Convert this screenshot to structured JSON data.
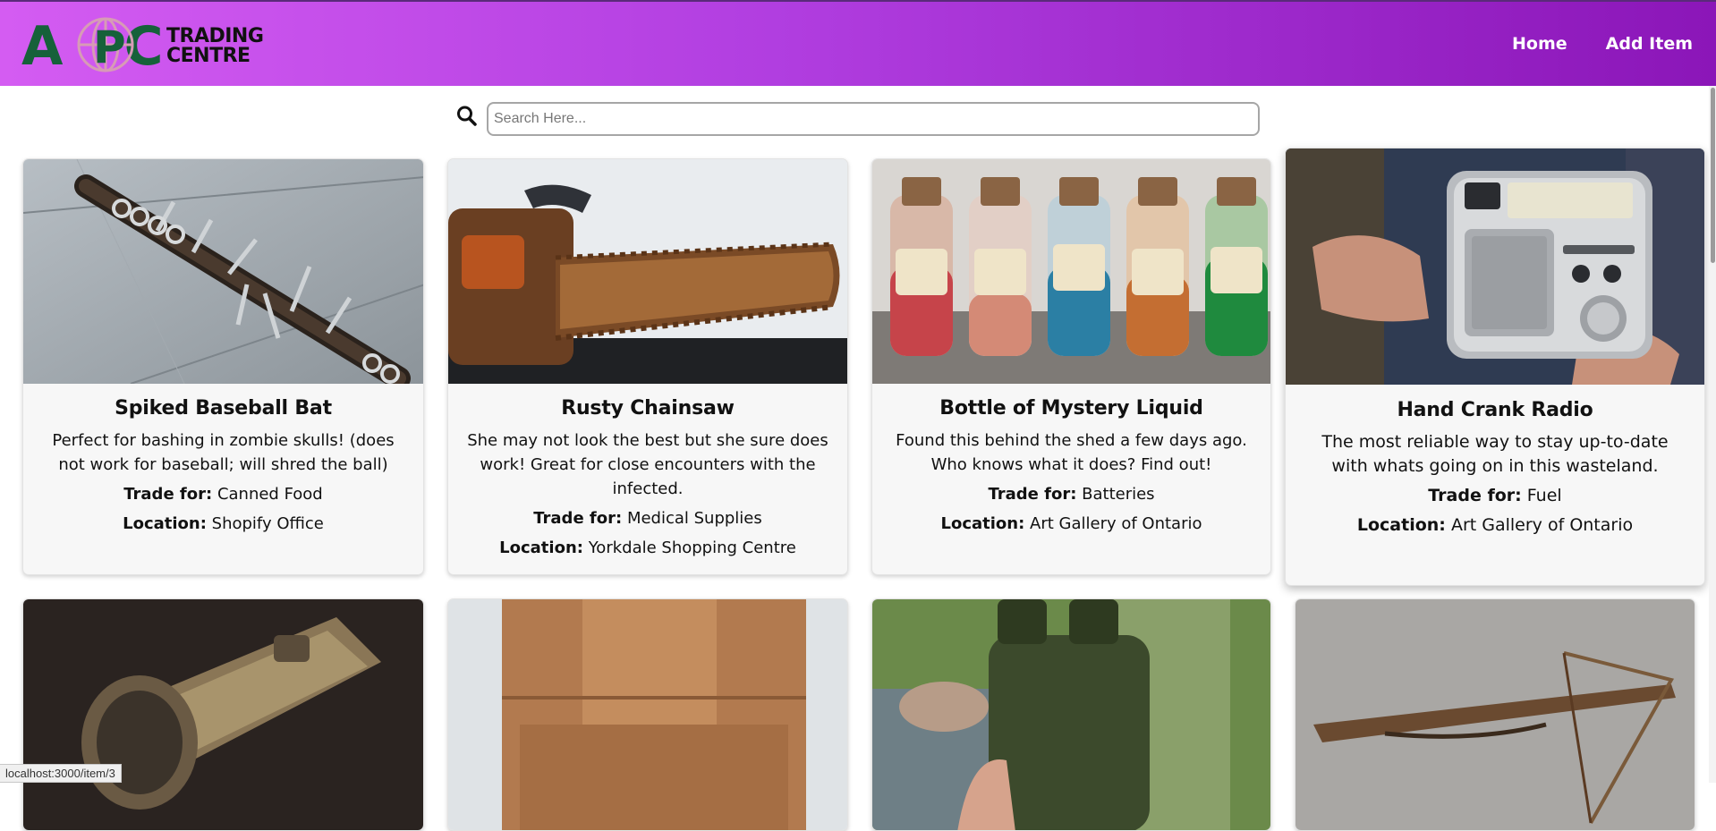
{
  "header": {
    "logo_letters": "APC",
    "logo_sub_line1": "TRADING",
    "logo_sub_line2": "CENTRE",
    "nav": [
      {
        "label": "Home"
      },
      {
        "label": "Add Item"
      }
    ],
    "gradient_colors": [
      "#d45cf2",
      "#8b16b8"
    ]
  },
  "search": {
    "placeholder": "Search Here...",
    "value": "",
    "icon": "search-icon"
  },
  "trade_label": "Trade for:",
  "location_label": "Location:",
  "items": [
    {
      "title": "Spiked Baseball Bat",
      "description": "Perfect for bashing in zombie skulls! (does not work for baseball; will shred the ball)",
      "trade_for": "Canned Food",
      "location": "Shopify Office",
      "image": "spiked-bat-photo"
    },
    {
      "title": "Rusty Chainsaw",
      "description": "She may not look the best but she sure does work! Great for close encounters with the infected.",
      "trade_for": "Medical Supplies",
      "location": "Yorkdale Shopping Centre",
      "image": "chainsaw-photo"
    },
    {
      "title": "Bottle of Mystery Liquid",
      "description": "Found this behind the shed a few days ago. Who knows what it does? Find out!",
      "trade_for": "Batteries",
      "location": "Art Gallery of Ontario",
      "image": "bottles-photo"
    },
    {
      "title": "Hand Crank Radio",
      "description": "The most reliable way to stay up-to-date with whats going on in this wasteland.",
      "trade_for": "Fuel",
      "location": "Art Gallery of Ontario",
      "image": "radio-photo"
    },
    {
      "image": "flashlight-photo"
    },
    {
      "image": "backpack-photo"
    },
    {
      "image": "canteen-photo"
    },
    {
      "image": "crossbow-photo"
    }
  ],
  "status_bar": {
    "url": "localhost:3000/item/3"
  }
}
